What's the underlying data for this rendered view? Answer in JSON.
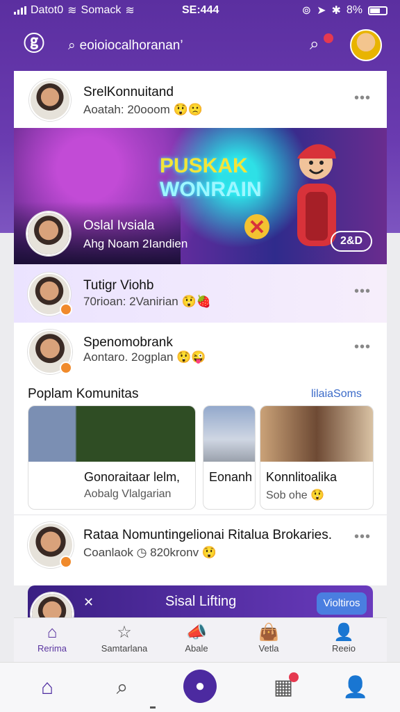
{
  "status_bar": {
    "carrier": "Datot0",
    "carrier2": "Somack",
    "time": "SE:444",
    "battery": "8%"
  },
  "header": {
    "search_text": "eoioiocalhoranan’"
  },
  "posts": [
    {
      "name": "SrelKonnuitand",
      "meta": "Aoatah: 20ooom"
    },
    {
      "name": "Tutigr Viohb",
      "meta": "70rioan: 2Vanirian"
    },
    {
      "name": "Spenomobrank",
      "meta": "Aontaro. 2ogplan"
    }
  ],
  "banner": {
    "title_line1": "PUSKAK",
    "title_line2": "WONRAIN",
    "name": "Oslal Ivsiala",
    "meta": "Ahg Noam 2Iandien",
    "pill": "2&D"
  },
  "section": {
    "title": "Poplam Komunitas",
    "link": "lilaiaSoms"
  },
  "communities": [
    {
      "title": "Gonoraitaar lelm,",
      "subtitle": "Aobalg Vlalgarian"
    },
    {
      "title": "Eonanh",
      "subtitle": ""
    },
    {
      "title": "Konnlitoalika",
      "subtitle": "Sob ohe"
    }
  ],
  "long_post": {
    "name": "Rataa Nomuntingelionai Ritalua Brokaries.",
    "meta": "Coanlaok",
    "meta2": "820kronv"
  },
  "promo": {
    "title": "Sisal Lifting",
    "button": "Violtiros"
  },
  "tabs": [
    {
      "label": "Rerima",
      "icon": "home-icon"
    },
    {
      "label": "Samtarlana",
      "icon": "star-icon"
    },
    {
      "label": "Abale",
      "icon": "megaphone-icon"
    },
    {
      "label": "Vetla",
      "icon": "bag-icon"
    },
    {
      "label": "Reeio",
      "icon": "person-icon"
    }
  ],
  "colors": {
    "primary": "#5a35a0",
    "accent": "#4a7ee0",
    "badge": "#e53950",
    "orange": "#f08a2b"
  }
}
